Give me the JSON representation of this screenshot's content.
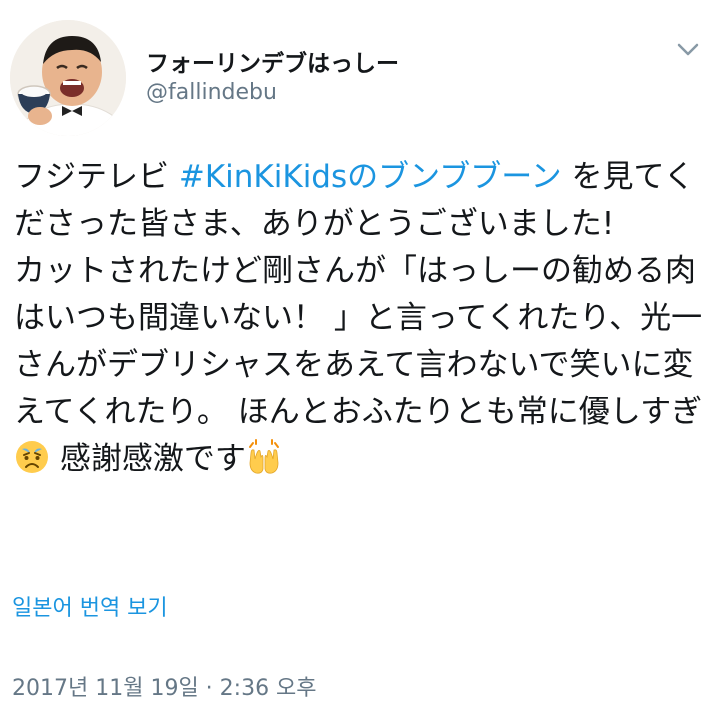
{
  "user": {
    "display_name": "フォーリンデブはっしー",
    "handle": "@fallindebu",
    "avatar_icon": "profile-photo"
  },
  "menu": {
    "icon": "chevron-down-icon"
  },
  "tweet": {
    "text_before_hashtag": "フジテレビ ",
    "hashtag": "#KinKiKidsのブンブブーン",
    "text_after_hashtag": " を見てくださった皆さま、ありがとうございました!\nカットされたけど剛さんが「はっしーの勧める肉はいつも間違いない！ 」と言ってくれたり、光一さんがデブリシャスをあえて言わないで笑いに変えてくれたり。 ほんとおふたりとも常に優しすぎ",
    "emoji_1": "crying-face-emoji",
    "text_after_emoji_1": " 感謝感激です",
    "emoji_2": "raising-hands-emoji"
  },
  "translate_label": "일본어 번역 보기",
  "timestamp": "2017년 11월 19일 · 2:36 오후",
  "colors": {
    "link": "#1b95e0",
    "secondary_text": "#657786",
    "primary_text": "#14171a",
    "background": "#ffffff"
  }
}
